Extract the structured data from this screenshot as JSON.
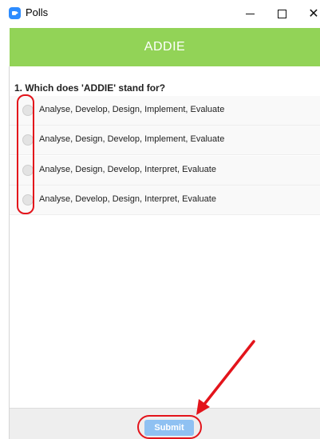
{
  "window": {
    "title": "Polls",
    "controls": {
      "minimize_icon": "minimize-icon",
      "maximize_icon": "maximize-icon",
      "close_icon": "close-icon",
      "close_glyph": "✕"
    }
  },
  "poll": {
    "header_title": "ADDIE",
    "header_color": "#92d357",
    "question": "1. Which does 'ADDIE' stand for?",
    "options": [
      {
        "label": "Analyse, Develop, Design, Implement, Evaluate",
        "selected": false
      },
      {
        "label": "Analyse, Design, Develop, Implement, Evaluate",
        "selected": false
      },
      {
        "label": "Analyse, Design, Develop, Interpret, Evaluate",
        "selected": false
      },
      {
        "label": "Analyse, Develop, Design, Interpret, Evaluate",
        "selected": false
      }
    ]
  },
  "footer": {
    "submit_label": "Submit",
    "submit_color": "#8fc1f2"
  },
  "annotations": {
    "color": "#e3141b"
  }
}
